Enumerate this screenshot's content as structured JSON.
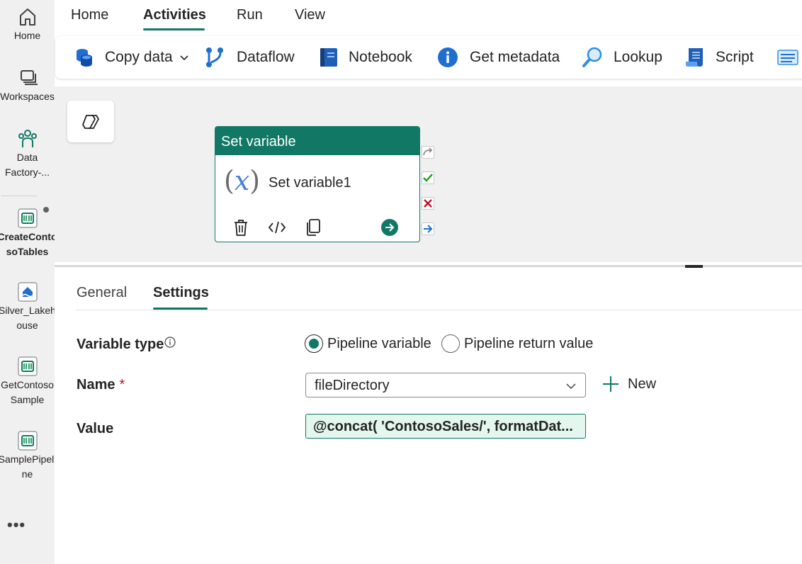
{
  "rail": {
    "items": [
      {
        "label": "Home"
      },
      {
        "label": "Workspaces"
      },
      {
        "label_line1": "Data",
        "label_line2": "Factory-..."
      },
      {
        "label_line1": "CreateConto",
        "label_line2": "soTables"
      },
      {
        "label_line1": "Silver_Lakeh",
        "label_line2": "ouse"
      },
      {
        "label_line1": "GetContoso",
        "label_line2": "Sample"
      },
      {
        "label_line1": "SamplePipeli",
        "label_line2": "ne"
      }
    ],
    "more": "•••"
  },
  "topnav": {
    "tabs": [
      {
        "label": "Home"
      },
      {
        "label": "Activities"
      },
      {
        "label": "Run"
      },
      {
        "label": "View"
      }
    ],
    "active": "Activities"
  },
  "toolbar": {
    "items": [
      {
        "label": "Copy data",
        "icon": "database-icon"
      },
      {
        "label": "Dataflow",
        "icon": "dataflow-icon"
      },
      {
        "label": "Notebook",
        "icon": "notebook-icon"
      },
      {
        "label": "Get metadata",
        "icon": "info-icon"
      },
      {
        "label": "Lookup",
        "icon": "lookup-icon"
      },
      {
        "label": "Script",
        "icon": "script-icon"
      }
    ]
  },
  "activity_card": {
    "type_label": "Set variable",
    "name": "Set variable1",
    "fx_open": "(",
    "fx_var": "x",
    "fx_close": ")"
  },
  "panel": {
    "tabs": [
      {
        "label": "General"
      },
      {
        "label": "Settings"
      }
    ],
    "active": "Settings",
    "variable_type": {
      "label": "Variable type",
      "options": [
        {
          "label": "Pipeline variable",
          "checked": true
        },
        {
          "label": "Pipeline return value",
          "checked": false
        }
      ]
    },
    "name": {
      "label": "Name",
      "required_mark": "*",
      "value": "fileDirectory",
      "new_label": "New"
    },
    "value": {
      "label": "Value",
      "text": "@concat( 'ContosoSales/', formatDat..."
    }
  },
  "colors": {
    "accent": "#117865",
    "rail_bg": "#f0f0f0",
    "canvas_bg": "#f0f0f0",
    "value_bg": "#e3f7ef",
    "required": "#c50f1f"
  }
}
